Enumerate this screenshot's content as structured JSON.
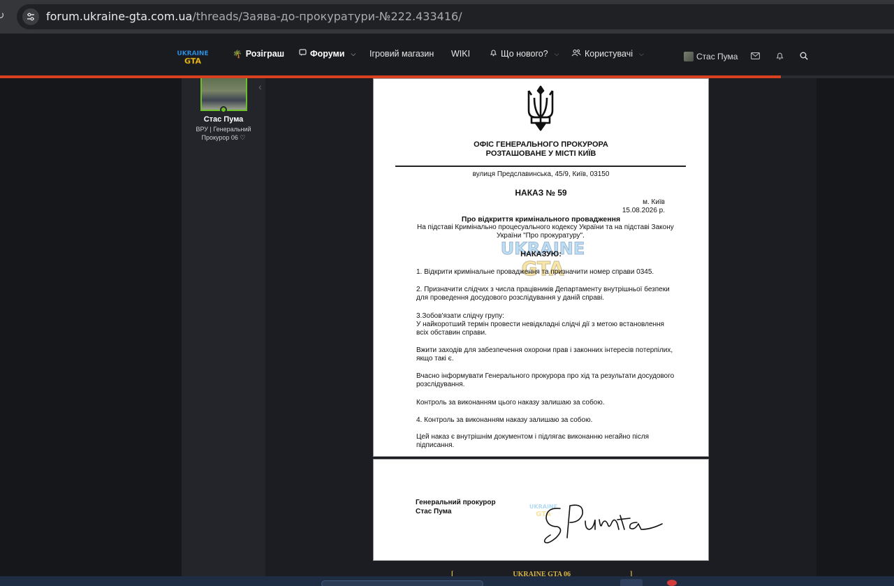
{
  "browser": {
    "url_host": "forum.ukraine-gta.com.ua",
    "url_path": "/threads/Заява-до-прокуратури-№222.433416/"
  },
  "nav": {
    "logo_text": "UKRAINE GTA",
    "items": [
      {
        "label": "Розіграш",
        "icon": "palm-icon"
      },
      {
        "label": "Форуми",
        "icon": "chat-icon"
      },
      {
        "label": "Ігровий магазин"
      },
      {
        "label": "WIKI"
      },
      {
        "label": "Що нового?",
        "icon": "bell-icon"
      },
      {
        "label": "Користувачі",
        "icon": "users-icon"
      }
    ],
    "user_name": "Стас Пума"
  },
  "author": {
    "name": "Стас Пума",
    "role_line1": "ВРУ | Генеральний",
    "role_line2": "Прокурор 06 ♡"
  },
  "document": {
    "office_line1": "ОФІС ГЕНЕРАЛЬНОГО ПРОКУРОРА",
    "office_line2": "РОЗТАШОВАНЕ У МІСТІ КИЇВ",
    "address": "вулиця Предславинська, 45/9, Київ, 03150",
    "order_title": "НАКАЗ № 59",
    "city": "м. Київ",
    "date": "15.08.2026 р.",
    "subject": "Про відкриття кримінального провадження",
    "basis_line1": "На підставі Кримінально процесуального кодексу України та на підставі Закону",
    "basis_line2": "України \"Про прокуратуру\".",
    "order_word": "НАКАЗУЮ:",
    "p1": "1. Відкрити кримінальне провадження та призначити номер справи 0345.",
    "p2a": "2. Призначити слідчих з числа працівників Департаменту внутрішньої безпеки",
    "p2b": "для проведення досудового розслідування у даній справі.",
    "p3a": "3.Зобов'язати слідчу групу:",
    "p3b": "У найкоротший термін провести невідкладні слідчі дії з метою встановлення",
    "p3c": "всіх обставин справи.",
    "p4a": "Вжити заходів для забезпечення охорони прав і законних інтересів потерпілих,",
    "p4b": "якщо такі є.",
    "p5a": "Вчасно інформувати Генерального прокурора про хід та результати досудового",
    "p5b": "розслідування.",
    "p6": "Контроль за виконанням цього наказу залишаю за собою.",
    "p7": "4. Контроль за виконанням наказу залишаю за собою.",
    "p8a": "Цей наказ є внутрішнім документом і підлягає виконанню негайно після",
    "p8b": "підписання.",
    "sign_title": "Генеральний прокурор",
    "sign_name": "Стас Пума"
  },
  "footer": {
    "text": "UKRAINE GTA 06"
  },
  "colors": {
    "accent_progress": "#d8411f",
    "online": "#6dbe2b",
    "gold": "#d8b64a"
  }
}
